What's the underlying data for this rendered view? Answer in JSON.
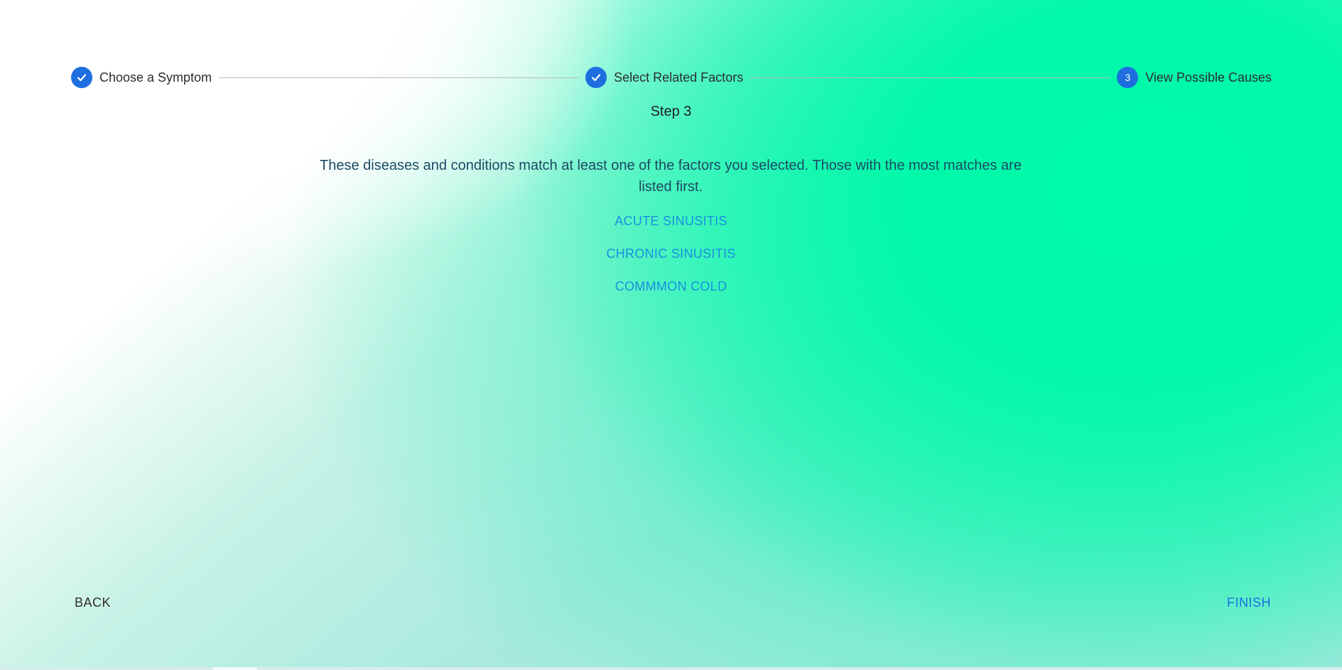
{
  "stepper": {
    "steps": [
      {
        "label": "Choose a Symptom",
        "state": "completed",
        "icon": "check-icon"
      },
      {
        "label": "Select Related Factors",
        "state": "completed",
        "icon": "check-icon"
      },
      {
        "label": "View Possible Causes",
        "state": "active",
        "number": "3"
      }
    ]
  },
  "main": {
    "step_title": "Step 3",
    "description": "These diseases and conditions match at least one of the factors you selected. Those with the most matches are listed first.",
    "results": [
      "ACUTE SINUSITIS",
      "CHRONIC SINUSITIS",
      "COMMMON COLD"
    ]
  },
  "footer": {
    "back_label": "BACK",
    "finish_label": "FINISH"
  },
  "colors": {
    "accent": "#1e6ee0",
    "link": "#1a8fe0",
    "background_green": "#00fcab"
  }
}
